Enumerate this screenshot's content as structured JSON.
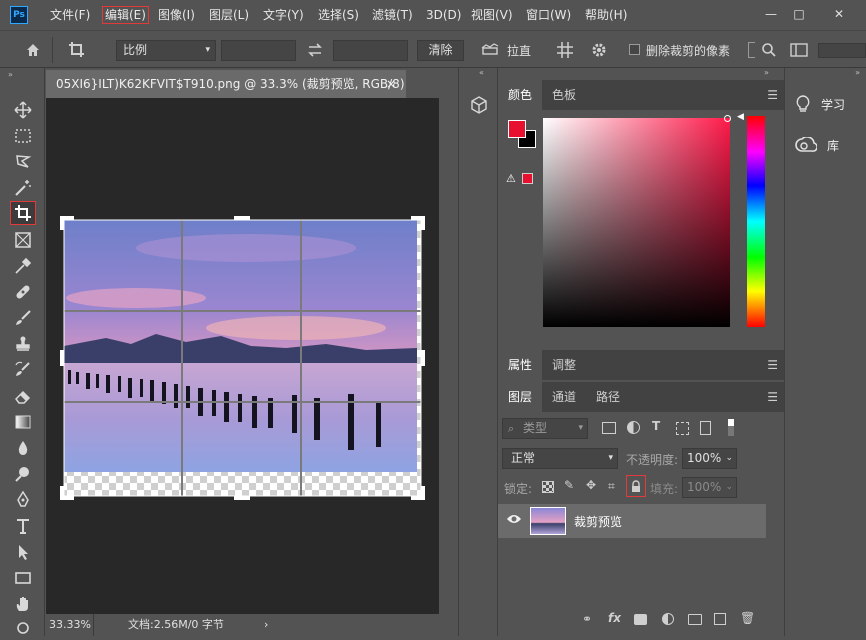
{
  "app": {
    "logo": "Ps",
    "window_controls": [
      "—",
      "□",
      "✕"
    ]
  },
  "menu": [
    {
      "label": "文件(F)"
    },
    {
      "label": "编辑(E)"
    },
    {
      "label": "图像(I)"
    },
    {
      "label": "图层(L)"
    },
    {
      "label": "文字(Y)"
    },
    {
      "label": "选择(S)"
    },
    {
      "label": "滤镜(T)"
    },
    {
      "label": "3D(D)"
    },
    {
      "label": "视图(V)"
    },
    {
      "label": "窗口(W)"
    },
    {
      "label": "帮助(H)"
    }
  ],
  "options": {
    "ratio_select": "比例",
    "clear_label": "清除",
    "straighten_label": "拉直",
    "delete_cropped_label": "删除裁剪的像素"
  },
  "document": {
    "tab_title": "05XI6}ILT)K62KFVIT$T910.png @ 33.3% (裁剪预览, RGB/8) *",
    "close": "×",
    "zoom": "33.33%",
    "doc_info": "文档:2.56M/0 字节",
    "status_arrow": "›"
  },
  "color_panel": {
    "tabs": [
      "颜色",
      "色板"
    ],
    "foreground": "#e8102f",
    "background": "#000000",
    "hue": "#ff1a4a"
  },
  "properties_panel": {
    "tabs": [
      "属性",
      "调整"
    ]
  },
  "layers_panel": {
    "tabs": [
      "图层",
      "通道",
      "路径"
    ],
    "filter_placeholder": "类型",
    "blend_mode": "正常",
    "opacity_label": "不透明度:",
    "opacity_value": "100%",
    "lock_label": "锁定:",
    "fill_label": "填充:",
    "fill_value": "100%",
    "layers": [
      {
        "name": "裁剪预览",
        "visible": true
      }
    ]
  },
  "learn_panel": {
    "items": [
      {
        "label": "学习",
        "icon": "lightbulb-icon"
      },
      {
        "label": "库",
        "icon": "creative-cloud-icon"
      }
    ]
  }
}
